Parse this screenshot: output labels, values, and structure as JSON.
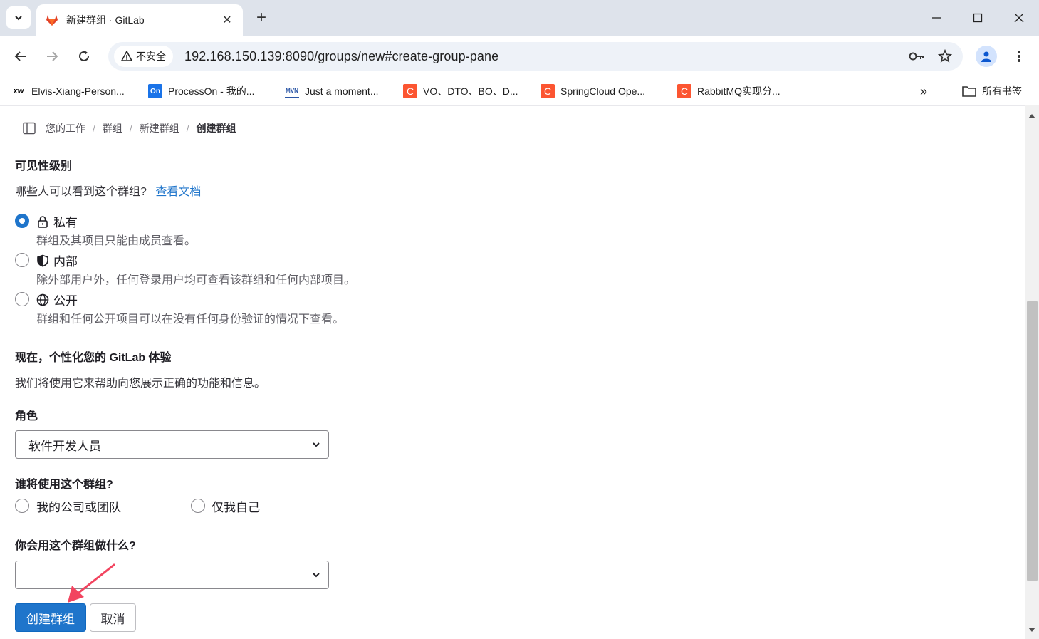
{
  "browser": {
    "tab_title": "新建群组 · GitLab",
    "security_label": "不安全",
    "url": "192.168.150.139:8090/groups/new#create-group-pane",
    "bookmarks": [
      {
        "icon_text": "xw",
        "label": "Elvis-Xiang-Person...",
        "icon_color": "#000000"
      },
      {
        "icon_text": "On",
        "label": "ProcessOn - 我的...",
        "icon_color": "#1a73e8"
      },
      {
        "icon_text": "MVN",
        "label": "Just a moment...",
        "icon_color": "#2b56a6"
      },
      {
        "icon_text": "C",
        "label": "VO、DTO、BO、D...",
        "icon_color": "#fc5531"
      },
      {
        "icon_text": "C",
        "label": "SpringCloud Ope...",
        "icon_color": "#fc5531"
      },
      {
        "icon_text": "C",
        "label": "RabbitMQ实现分...",
        "icon_color": "#fc5531"
      }
    ],
    "bookmarks_overflow": "»",
    "all_bookmarks_label": "所有书签"
  },
  "breadcrumb": [
    "您的工作",
    "群组",
    "新建群组",
    "创建群组"
  ],
  "visibility": {
    "heading": "可见性级别",
    "question": "哪些人可以看到这个群组?",
    "docs_link": "查看文档",
    "options": [
      {
        "label": "私有",
        "icon": "lock-icon",
        "help": "群组及其项目只能由成员查看。",
        "checked": true
      },
      {
        "label": "内部",
        "icon": "shield-icon",
        "help": "除外部用户外，任何登录用户均可查看该群组和任何内部项目。",
        "checked": false
      },
      {
        "label": "公开",
        "icon": "globe-icon",
        "help": "群组和任何公开项目可以在没有任何身份验证的情况下查看。",
        "checked": false
      }
    ]
  },
  "personalize": {
    "heading": "现在，个性化您的 GitLab 体验",
    "description": "我们将使用它来帮助向您展示正确的功能和信息。"
  },
  "role": {
    "label": "角色",
    "selected": "软件开发人员"
  },
  "who": {
    "label": "谁将使用这个群组?",
    "options": [
      "我的公司或团队",
      "仅我自己"
    ]
  },
  "purpose": {
    "label": "你会用这个群组做什么?",
    "selected": ""
  },
  "actions": {
    "create": "创建群组",
    "cancel": "取消"
  },
  "colors": {
    "accent": "#1f75cb",
    "annotation_arrow": "#f2445f"
  }
}
